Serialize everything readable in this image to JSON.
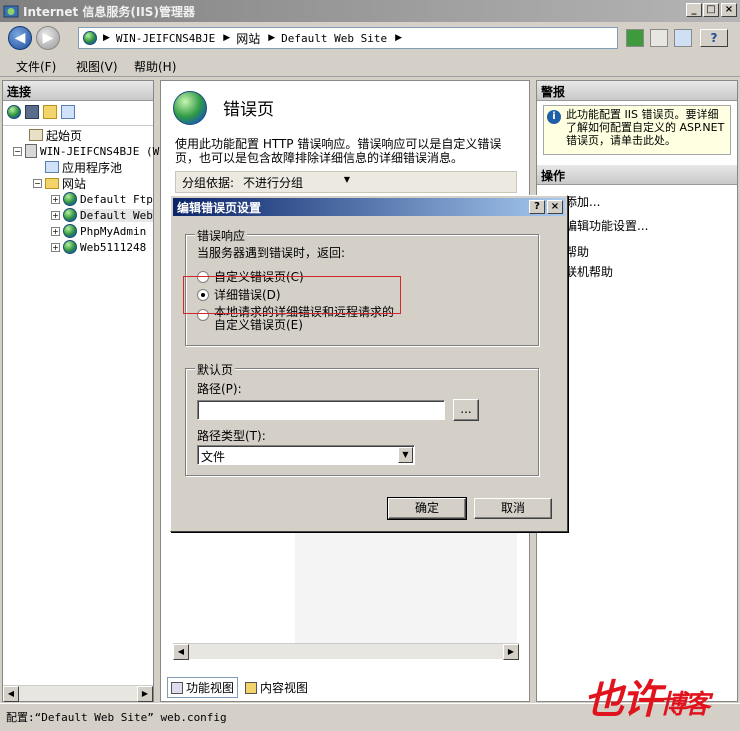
{
  "window": {
    "title": "Internet 信息服务(IIS)管理器",
    "min_label": "_",
    "max_label": "□",
    "close_label": "×"
  },
  "address": {
    "server": "WIN-JEIFCNS4BJE",
    "sites": "网站",
    "site": "Default Web Site",
    "sep": "▶",
    "help_icon_label": "?"
  },
  "menu": {
    "file": "文件(F)",
    "view": "视图(V)",
    "help": "帮助(H)"
  },
  "connections": {
    "header": "连接",
    "tree": {
      "start": "起始页",
      "server": "WIN-JEIFCNS4BJE (W",
      "apppools": "应用程序池",
      "sites": "网站",
      "items": [
        "Default Ftp",
        "Default Web",
        "PhpMyAdmin",
        "Web5111248"
      ]
    }
  },
  "center": {
    "page_title": "错误页",
    "description": "使用此功能配置 HTTP 错误响应。错误响应可以是自定义错误页，也可以是包含故障排除详细信息的详细错误消息。",
    "group_by_label": "分组依据:",
    "group_by_value": "不进行分组",
    "tab_features": "功能视图",
    "tab_content": "内容视图"
  },
  "right": {
    "alerts_header": "警报",
    "alert_text": "此功能配置 IIS 错误页。要详细了解如何配置自定义的 ASP.NET 错误页，请单击此处。",
    "actions_header": "操作",
    "actions": [
      "添加...",
      "编辑功能设置...",
      "帮助",
      "联机帮助"
    ]
  },
  "dialog": {
    "title": "编辑错误页设置",
    "help_btn": "?",
    "close_btn": "×",
    "error_response_group": "错误响应",
    "prompt": "当服务器遇到错误时，返回:",
    "options": [
      "自定义错误页(C)",
      "详细错误(D)",
      "本地请求的详细错误和远程请求的自定义错误页(E)"
    ],
    "option3_line1": "本地请求的详细错误和远程请求的",
    "option3_line2": "自定义错误页(E)",
    "selected_option": 1,
    "default_page_group": "默认页",
    "path_label": "路径(P):",
    "path_value": "",
    "browse_label": "...",
    "path_type_label": "路径类型(T):",
    "path_type_value": "文件",
    "ok": "确定",
    "cancel": "取消"
  },
  "status": {
    "text": "配置:“Default Web Site” web.config"
  },
  "colors": {
    "highlight_box": "#d0262c",
    "watermark": "#e1141e"
  }
}
